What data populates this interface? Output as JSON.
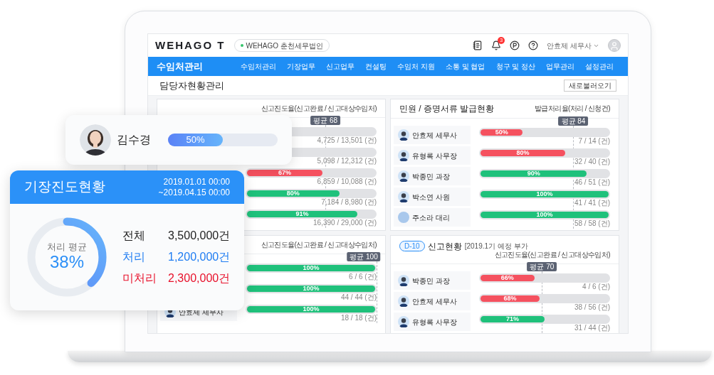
{
  "laptop_screen": {
    "header": {
      "logo": "WEHAGO T",
      "company": "WEHAGO 춘천세무법인",
      "notification_count": "3",
      "user": "안효제 세무사"
    },
    "nav": {
      "title": "수임처관리",
      "items": [
        "수임처관리",
        "기장업무",
        "신고업무",
        "컨설팅",
        "수임처 지원",
        "소통 및 협업",
        "청구 및 정산",
        "업무관리",
        "설정관리"
      ]
    },
    "page_title": "담당자현황관리",
    "refresh_button": "새로불러오기",
    "panels": [
      {
        "legend": "신고진도율(신고완료 / 신고대상수임처)",
        "average": {
          "label": "평균 68",
          "level": 0.61
        },
        "rows": [
          {
            "count": "4,725 / 13,501 (건)"
          },
          {
            "count": "5,098 / 12,312 (건)"
          },
          {
            "level": 0.59,
            "label": "67%",
            "color": "#f5515f",
            "count": "6,859 / 10,088 (건)"
          },
          {
            "level": 0.72,
            "label": "80%",
            "color": "#1fc17b",
            "count": "7,184 / 8,980 (건)"
          },
          {
            "level": 0.86,
            "label": "91%",
            "color": "#1fc17b",
            "count": "16,390 / 29,000 (건)"
          }
        ]
      },
      {
        "title": "민원 / 증명서류 발급현황",
        "legend": "발급처리율(처리 / 신청건)",
        "average": {
          "label": "평균 84",
          "level": 0.72
        },
        "rows": [
          {
            "name": "안효제 세무사",
            "level": 0.33,
            "label": "50%",
            "color": "#f5515f",
            "count": "7 / 14 (건)"
          },
          {
            "name": "유형록 사무장",
            "level": 0.66,
            "label": "80%",
            "color": "#f5515f",
            "count": "32 / 40 (건)"
          },
          {
            "name": "박종민 과장",
            "level": 0.83,
            "label": "90%",
            "color": "#1fc17b",
            "count": "46 / 51 (건)"
          },
          {
            "name": "박소연 사원",
            "level": 1,
            "label": "100%",
            "color": "#1fc17b",
            "count": "41 / 41 (건)"
          },
          {
            "name": "주소라 대리",
            "kind": "blank",
            "level": 1,
            "label": "100%",
            "color": "#1fc17b",
            "count": "58 / 58 (건)"
          }
        ]
      },
      {
        "legend": "신고진도율(신고완료 / 신고대상수임처)",
        "average": {
          "label": "평균 100",
          "level": 1
        },
        "rows": [
          {
            "level": 1,
            "label": "100%",
            "color": "#1fc17b",
            "count": "6 / 6 (건)"
          },
          {
            "level": 1,
            "label": "100%",
            "color": "#1fc17b",
            "count": "44 / 44 (건)"
          },
          {
            "name": "안효제 세무사",
            "level": 1,
            "label": "100%",
            "color": "#1fc17b",
            "count": "18 / 18 (건)"
          }
        ]
      },
      {
        "badge": "D-10",
        "title": "신고현황",
        "subtitle": "[2019.1기 예정 부가",
        "legend": "신고진도율(신고완료 / 신고대상수임처)",
        "average": {
          "label": "평균 70",
          "level": 0.48
        },
        "rows": [
          {
            "name": "박종민 과장",
            "level": 0.42,
            "label": "66%",
            "color": "#f5515f",
            "count": "4 / 6 (건)"
          },
          {
            "name": "안효제 세무사",
            "level": 0.46,
            "label": "68%",
            "color": "#f5515f",
            "count": "38 / 56 (건)"
          },
          {
            "name": "유형록 사무장",
            "level": 0.5,
            "label": "71%",
            "color": "#1fc17b",
            "count": "31 / 44 (건)"
          }
        ]
      }
    ]
  },
  "profile_card": {
    "name": "김수경",
    "level": 0.5,
    "label": "50%"
  },
  "summary_card": {
    "title": "기장진도현황",
    "dates": [
      "2019.01.01 00:00",
      "~2019.04.15 00:00"
    ],
    "donut": {
      "caption": "처리 평균",
      "value": "38%",
      "level": 0.38
    },
    "stats": [
      {
        "label": "전체",
        "value": "3,500,000건",
        "color": "#222222"
      },
      {
        "label": "처리",
        "value": "1,200,000건",
        "color": "#1e7cf2"
      },
      {
        "label": "미처리",
        "value": "2,300,000건",
        "color": "#e8102a"
      }
    ]
  }
}
